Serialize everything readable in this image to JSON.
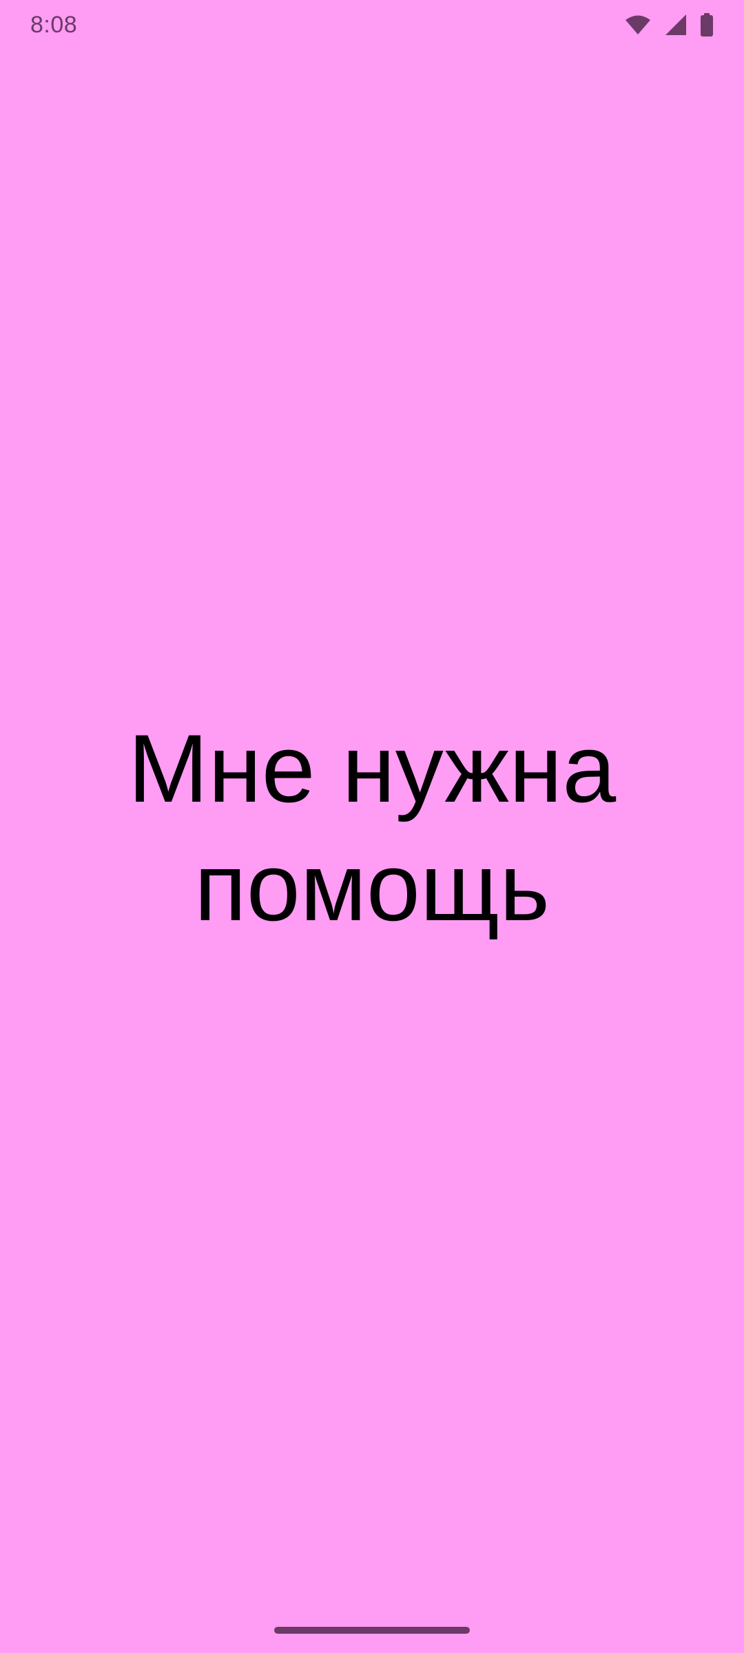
{
  "status_bar": {
    "time": "8:08",
    "icons": [
      "wifi-icon",
      "cellular-signal-icon",
      "battery-icon"
    ],
    "icon_color": "#6b3a67"
  },
  "main": {
    "message_line1": "Мне нужна",
    "message_line2": "помощь"
  },
  "colors": {
    "background": "#ff9cf4",
    "text": "#000000"
  }
}
